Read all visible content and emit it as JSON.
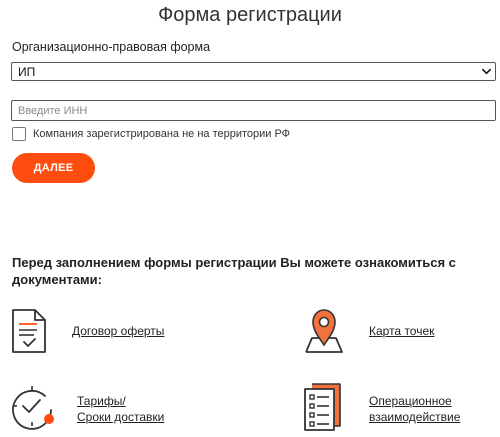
{
  "form": {
    "title": "Форма регистрации",
    "org_label": "Организационно-правовая форма",
    "org_select": {
      "selected": "ИП"
    },
    "inn_input": {
      "value": "",
      "placeholder": "Введите ИНН"
    },
    "foreign_company": {
      "checked": false,
      "label": "Компания зарегистрирована не на территории РФ"
    },
    "submit_label": "ДАЛЕЕ"
  },
  "documents": {
    "heading": "Перед заполнением формы регистрации Вы можете ознакомиться с документами:",
    "items": [
      {
        "icon": "contract-document-icon",
        "label": "Договор оферты"
      },
      {
        "icon": "map-pin-icon",
        "label": "Карта точек"
      },
      {
        "icon": "clock-checkmark-icon",
        "label_line1": "Тарифы/",
        "label_line2": "Сроки доставки"
      },
      {
        "icon": "checklist-document-icon",
        "label_line1": "Операционное",
        "label_line2": "взаимодействие"
      }
    ]
  },
  "colors": {
    "accent": "#ff4c0f",
    "icon_stroke": "#333333"
  }
}
